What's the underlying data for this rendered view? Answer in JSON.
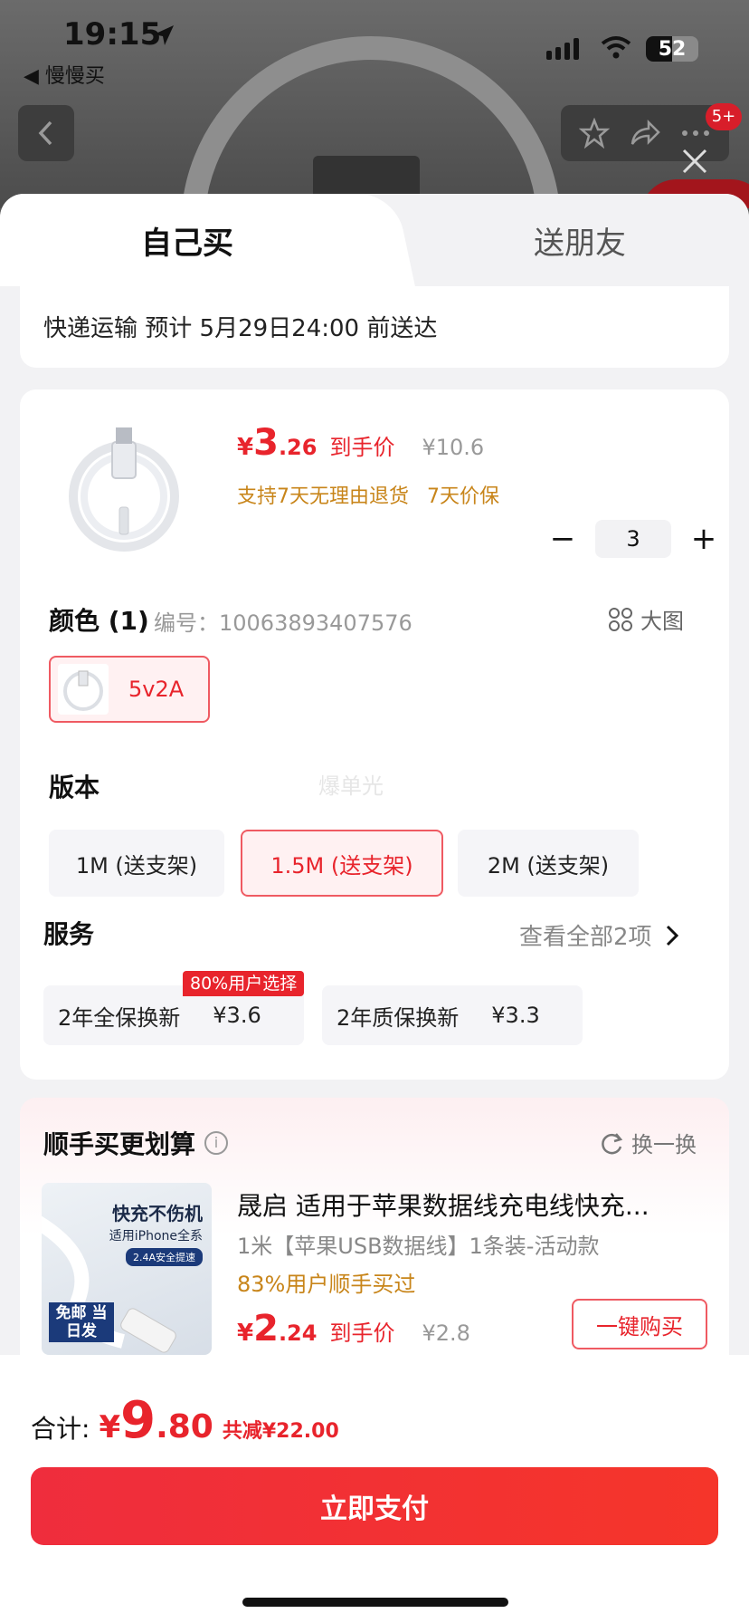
{
  "status_bar": {
    "time": "19:15",
    "back_app": "◀ 慢慢买",
    "battery": "52"
  },
  "header": {
    "badge": "5+"
  },
  "tabs": {
    "self": "自己买",
    "friend": "送朋友"
  },
  "delivery": {
    "text": "快递运输 预计 5月29日24:00 前送达"
  },
  "product": {
    "price_yen": "¥",
    "price_int": "3",
    "price_dec": ".26",
    "price_label": "到手价",
    "original_price": "¥10.6",
    "return_policy": "支持7天无理由退货",
    "price_protect": "7天价保",
    "quantity": "3",
    "minus": "−",
    "plus": "+"
  },
  "color": {
    "title": "颜色 (1)",
    "code": "编号：10063893407576",
    "big_pic": "大图",
    "options": [
      {
        "label": "5v2A",
        "selected": true
      }
    ]
  },
  "version": {
    "title": "版本",
    "watermark": "爆单光",
    "options": [
      {
        "label": "1M (送支架)",
        "selected": false
      },
      {
        "label": "1.5M (送支架)",
        "selected": true
      },
      {
        "label": "2M (送支架)",
        "selected": false
      }
    ]
  },
  "service": {
    "title": "服务",
    "view_all": "查看全部2项",
    "tag": "80%用户选择",
    "options": [
      {
        "name": "2年全保换新",
        "price": "¥3.6"
      },
      {
        "name": "2年质保换新",
        "price": "¥3.3"
      }
    ]
  },
  "addon": {
    "title": "顺手买更划算",
    "swap": "换一换",
    "thumb_headline": "快充不伤机",
    "thumb_sub": "适用iPhone全系",
    "thumb_tag": "2.4A安全提速",
    "thumb_free": "免邮 当日发",
    "name": "晟启 适用于苹果数据线充电线快充...",
    "sub": "1米【苹果USB数据线】1条装-活动款",
    "buyers": "83%用户顺手买过",
    "price_yen": "¥",
    "price_int": "2",
    "price_dec": ".24",
    "price_label": "到手价",
    "original_price": "¥2.8",
    "buy_button": "一键购买"
  },
  "footer": {
    "total_label": "合计:",
    "total_yen": "¥",
    "total_int": "9",
    "total_dec": ".80",
    "saving": "共减¥22.00",
    "pay_button": "立即支付"
  },
  "colors": {
    "accent_red": "#e8242c",
    "gold": "#c8851a"
  }
}
